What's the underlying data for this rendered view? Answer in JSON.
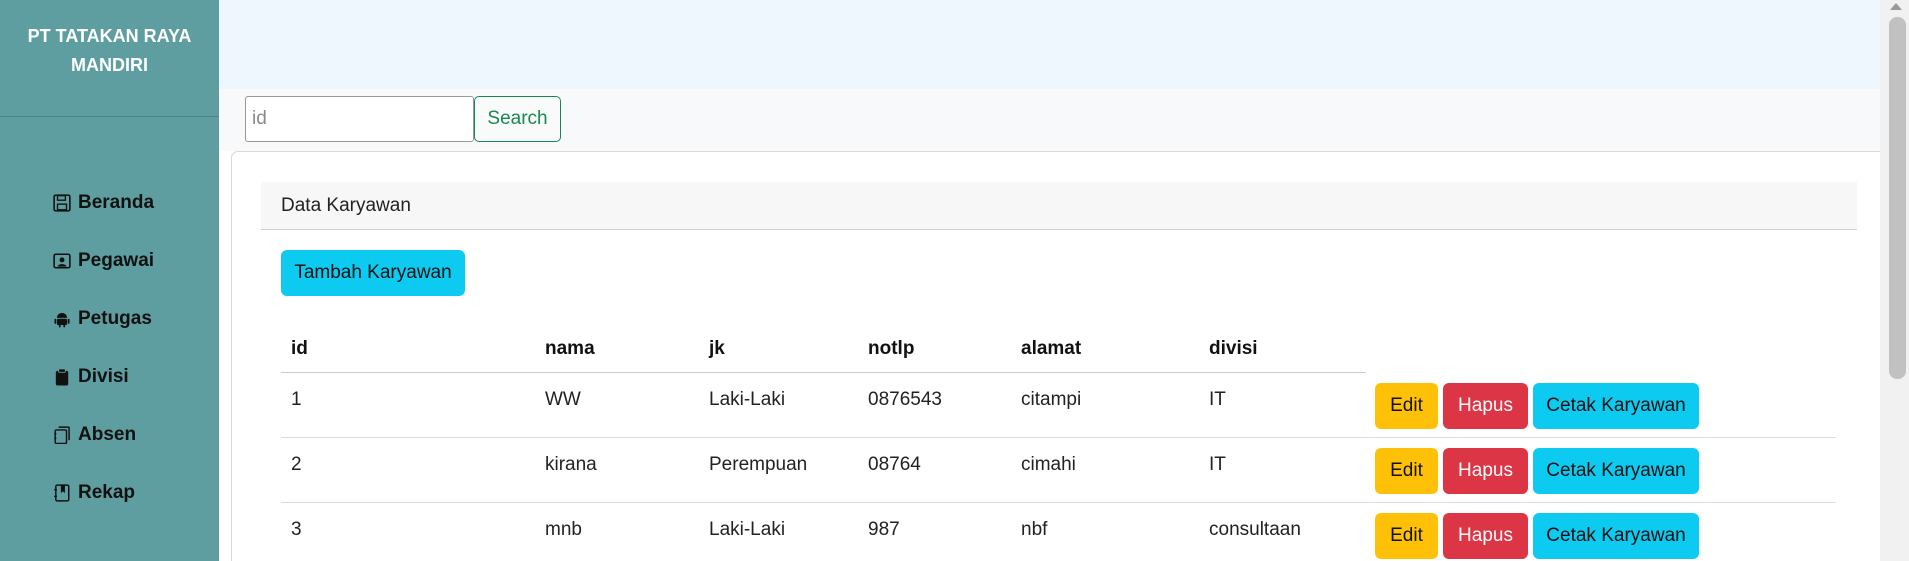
{
  "brand": {
    "line1": "PT TATAKAN RAYA",
    "line2": "MANDIRI"
  },
  "nav": [
    {
      "label": "Beranda",
      "icon": "save-icon"
    },
    {
      "label": "Pegawai",
      "icon": "person-badge-icon"
    },
    {
      "label": "Petugas",
      "icon": "android-icon"
    },
    {
      "label": "Divisi",
      "icon": "clipboard-icon"
    },
    {
      "label": "Absen",
      "icon": "journals-icon"
    },
    {
      "label": "Rekap",
      "icon": "journal-bookmark-icon"
    }
  ],
  "search": {
    "placeholder": "id",
    "value": "",
    "button": "Search"
  },
  "card": {
    "title": "Data Karyawan",
    "add_button": "Tambah Karyawan"
  },
  "table": {
    "headers": [
      "id",
      "nama",
      "jk",
      "notlp",
      "alamat",
      "divisi"
    ],
    "rows": [
      {
        "id": "1",
        "nama": "WW",
        "jk": "Laki-Laki",
        "notlp": "0876543",
        "alamat": "citampi",
        "divisi": "IT"
      },
      {
        "id": "2",
        "nama": "kirana",
        "jk": "Perempuan",
        "notlp": "08764",
        "alamat": "cimahi",
        "divisi": "IT"
      },
      {
        "id": "3",
        "nama": "mnb",
        "jk": "Laki-Laki",
        "notlp": "987",
        "alamat": "nbf",
        "divisi": "consultaan"
      }
    ],
    "actions": {
      "edit": "Edit",
      "hapus": "Hapus",
      "cetak": "Cetak Karyawan"
    }
  },
  "colors": {
    "sidebar": "#5f9ea0",
    "topbar": "#eef7fd",
    "info": "#0dcaf0",
    "warning": "#ffc107",
    "danger": "#dc3545",
    "success": "#198754"
  }
}
